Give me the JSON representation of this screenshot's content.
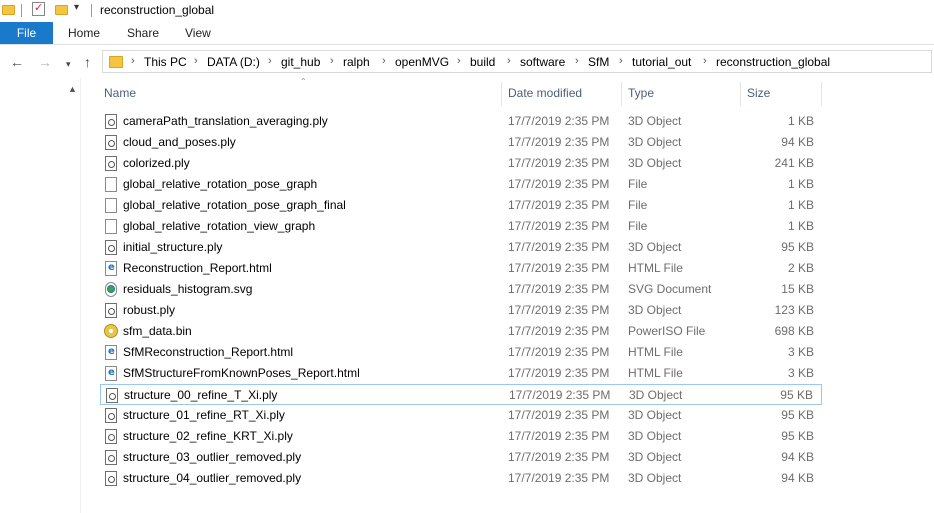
{
  "window": {
    "title": "reconstruction_global"
  },
  "ribbon": {
    "tabs": [
      "File",
      "Home",
      "Share",
      "View"
    ]
  },
  "address": {
    "crumbs": [
      "This PC",
      "DATA (D:)",
      "git_hub",
      "ralph",
      "openMVG",
      "build",
      "software",
      "SfM",
      "tutorial_out",
      "reconstruction_global"
    ]
  },
  "columns": {
    "name": "Name",
    "date": "Date modified",
    "type": "Type",
    "size": "Size"
  },
  "files": [
    {
      "name": "cameraPath_translation_averaging.ply",
      "date": "17/7/2019 2:35 PM",
      "type": "3D Object",
      "size": "1 KB",
      "icon": "3d"
    },
    {
      "name": "cloud_and_poses.ply",
      "date": "17/7/2019 2:35 PM",
      "type": "3D Object",
      "size": "94 KB",
      "icon": "3d"
    },
    {
      "name": "colorized.ply",
      "date": "17/7/2019 2:35 PM",
      "type": "3D Object",
      "size": "241 KB",
      "icon": "3d"
    },
    {
      "name": "global_relative_rotation_pose_graph",
      "date": "17/7/2019 2:35 PM",
      "type": "File",
      "size": "1 KB",
      "icon": "doc"
    },
    {
      "name": "global_relative_rotation_pose_graph_final",
      "date": "17/7/2019 2:35 PM",
      "type": "File",
      "size": "1 KB",
      "icon": "doc"
    },
    {
      "name": "global_relative_rotation_view_graph",
      "date": "17/7/2019 2:35 PM",
      "type": "File",
      "size": "1 KB",
      "icon": "doc"
    },
    {
      "name": "initial_structure.ply",
      "date": "17/7/2019 2:35 PM",
      "type": "3D Object",
      "size": "95 KB",
      "icon": "3d"
    },
    {
      "name": "Reconstruction_Report.html",
      "date": "17/7/2019 2:35 PM",
      "type": "HTML File",
      "size": "2 KB",
      "icon": "html"
    },
    {
      "name": "residuals_histogram.svg",
      "date": "17/7/2019 2:35 PM",
      "type": "SVG Document",
      "size": "15 KB",
      "icon": "svg"
    },
    {
      "name": "robust.ply",
      "date": "17/7/2019 2:35 PM",
      "type": "3D Object",
      "size": "123 KB",
      "icon": "3d"
    },
    {
      "name": "sfm_data.bin",
      "date": "17/7/2019 2:35 PM",
      "type": "PowerISO File",
      "size": "698 KB",
      "icon": "disc"
    },
    {
      "name": "SfMReconstruction_Report.html",
      "date": "17/7/2019 2:35 PM",
      "type": "HTML File",
      "size": "3 KB",
      "icon": "html"
    },
    {
      "name": "SfMStructureFromKnownPoses_Report.html",
      "date": "17/7/2019 2:35 PM",
      "type": "HTML File",
      "size": "3 KB",
      "icon": "html"
    },
    {
      "name": "structure_00_refine_T_Xi.ply",
      "date": "17/7/2019 2:35 PM",
      "type": "3D Object",
      "size": "95 KB",
      "icon": "3d",
      "selected": true
    },
    {
      "name": "structure_01_refine_RT_Xi.ply",
      "date": "17/7/2019 2:35 PM",
      "type": "3D Object",
      "size": "95 KB",
      "icon": "3d"
    },
    {
      "name": "structure_02_refine_KRT_Xi.ply",
      "date": "17/7/2019 2:35 PM",
      "type": "3D Object",
      "size": "95 KB",
      "icon": "3d"
    },
    {
      "name": "structure_03_outlier_removed.ply",
      "date": "17/7/2019 2:35 PM",
      "type": "3D Object",
      "size": "94 KB",
      "icon": "3d"
    },
    {
      "name": "structure_04_outlier_removed.ply",
      "date": "17/7/2019 2:35 PM",
      "type": "3D Object",
      "size": "94 KB",
      "icon": "3d"
    }
  ]
}
